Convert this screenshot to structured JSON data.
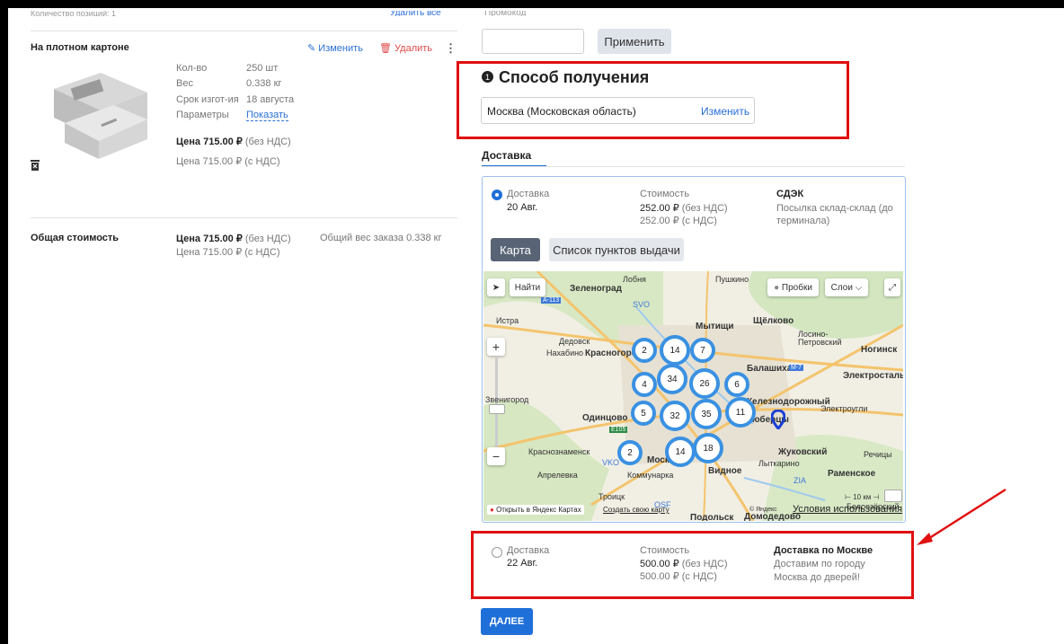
{
  "left": {
    "cut_header": "Количество позиций: 1",
    "cut_action": "Удалить все",
    "product": {
      "title": "На плотном картоне",
      "edit_label": "Изменить",
      "delete_label": "Удалить",
      "specs": [
        {
          "label": "Кол-во",
          "value": "250 шт"
        },
        {
          "label": "Вес",
          "value": "0.338 кг"
        },
        {
          "label": "Срок изгот-ия",
          "value": "18 августа"
        },
        {
          "label": "Параметры",
          "value": "Показать"
        }
      ],
      "price_line1_bold": "Цена 715.00 ₽",
      "price_line1_rest": "(без НДС)",
      "price_line2": "Цена 715.00 ₽ (с НДС)"
    },
    "total": {
      "label": "Общая стоимость",
      "price_bold": "Цена 715.00 ₽",
      "price_rest": "(без НДС)",
      "price_vat": "Цена 715.00 ₽ (с НДС)",
      "weight": "Общий вес заказа 0.338 кг"
    }
  },
  "right": {
    "cut_label": "Промокод",
    "promo_value": "",
    "apply_label": "Применить",
    "section_title": "Способ получения",
    "location_value": "Москва (Московская область)",
    "location_change": "Изменить",
    "tab_label": "Доставка",
    "option1": {
      "type": "Доставка",
      "date": "20 Авг.",
      "cost_label": "Стоимость",
      "cost_bold1": "252.00 ₽",
      "cost_rest1": "(без НДС)",
      "cost2": "252.00 ₽ (с НДС)",
      "carrier": "СДЭК",
      "desc": "Посылка склад-склад (до терминала)",
      "selected": true
    },
    "map_tabs": [
      "Карта",
      "Список пунктов выдачи"
    ],
    "map": {
      "find": "Найти",
      "traffic": "Пробки",
      "layers": "Слои",
      "open_yandex": "Открыть в Яндекс Картах",
      "create_map": "Создать свою карту",
      "yandex": "© Яндекс",
      "terms": "Условия использования",
      "scale": "10 км",
      "places": [
        "Зеленоград",
        "Лобня",
        "Пушкино",
        "Истра",
        "Мытищи",
        "Щёлково",
        "Лосино-Петровский",
        "Дедовск",
        "Нахабино",
        "Красногорск",
        "Балашиха",
        "Ногинск",
        "Электросталь",
        "Звенигород",
        "Одинцово",
        "Железнодорожный",
        "Электроугли",
        "Люберцы",
        "Краснознаменск",
        "Москва",
        "Жуковский",
        "Апрелевка",
        "Коммунарка",
        "Видное",
        "Лыткарино",
        "Раменское",
        "Троицк",
        "Подольск",
        "Домодедово",
        "Белоозёрский",
        "Речицы"
      ],
      "road_signs": [
        "А-113",
        "М-7",
        "Е105"
      ],
      "airports": [
        "SVO",
        "VKO",
        "ZIA",
        "OSF"
      ],
      "clusters": [
        "2",
        "14",
        "7",
        "4",
        "34",
        "26",
        "6",
        "5",
        "32",
        "35",
        "11",
        "2",
        "14",
        "18"
      ]
    },
    "option2": {
      "type": "Доставка",
      "date": "22 Авг.",
      "cost_label": "Стоимость",
      "cost_bold1": "500.00 ₽",
      "cost_rest1": "(без НДС)",
      "cost2": "500.00 ₽ (с НДС)",
      "carrier": "Доставка по Москве",
      "desc": "Доставим по городу Москва до дверей!",
      "selected": false
    },
    "next_label": "ДАЛЕЕ"
  },
  "colors": {
    "accent": "#1f6fd8",
    "highlight": "#e01010",
    "delete": "#e04b4b",
    "cluster": "#3a91e2"
  }
}
